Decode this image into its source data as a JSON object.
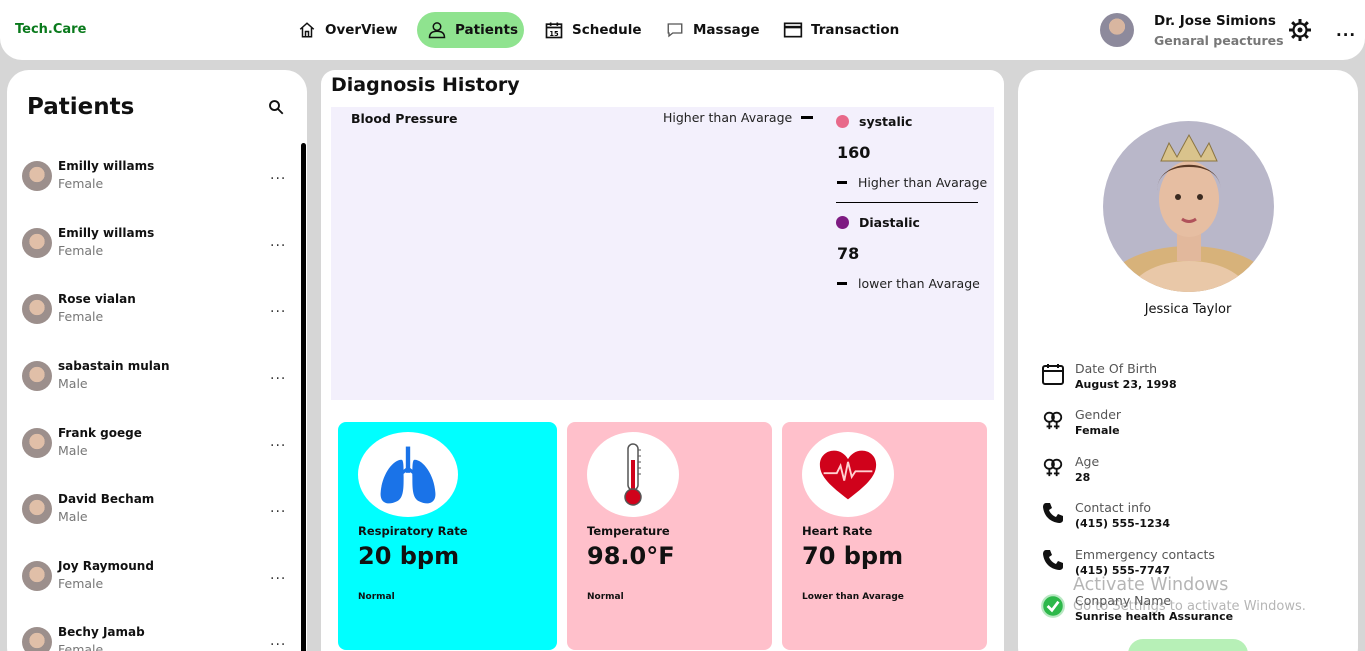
{
  "brand": "Tech.Care",
  "nav": {
    "overview": "OverView",
    "patients": "Patients",
    "schedule": "Schedule",
    "message": "Massage",
    "transaction": "Transaction"
  },
  "doctor": {
    "name": "Dr. Jose Simions",
    "role": "Genaral peactures"
  },
  "patients_panel": {
    "title": "Patients",
    "more_label": "...",
    "items": [
      {
        "name": "Emilly willams",
        "gender": "Female"
      },
      {
        "name": "Emilly willams",
        "gender": "Female"
      },
      {
        "name": "Rose vialan",
        "gender": "Female"
      },
      {
        "name": "sabastain mulan",
        "gender": "Male"
      },
      {
        "name": "Frank goege",
        "gender": "Male"
      },
      {
        "name": "David Becham",
        "gender": "Male"
      },
      {
        "name": "Joy Raymound",
        "gender": "Female"
      },
      {
        "name": "Bechy Jamab",
        "gender": "Female"
      }
    ]
  },
  "diagnosis": {
    "title": "Diagnosis History",
    "blood_pressure": {
      "title": "Blood Pressure",
      "note": "Higher than Avarage",
      "systolic": {
        "label": "systalic",
        "value": "160",
        "note": "Higher than Avarage",
        "color": "#e8698a"
      },
      "diastolic": {
        "label": "Diastalic",
        "value": "78",
        "note": "lower than Avarage",
        "color": "#7e1b82"
      }
    },
    "vitals": [
      {
        "label": "Respiratory Rate",
        "value": "20 bpm",
        "status": "Normal",
        "color": "#00ffff",
        "icon": "lungs-icon"
      },
      {
        "label": "Temperature",
        "value": "98.0°F",
        "status": "Normal",
        "color": "#ffc0cb",
        "icon": "thermometer-icon"
      },
      {
        "label": "Heart Rate",
        "value": "70 bpm",
        "status": "Lower than Avarage",
        "color": "#ffc0cb",
        "icon": "heart-icon"
      }
    ]
  },
  "profile": {
    "name": "Jessica Taylor",
    "dob_label": "Date Of Birth",
    "dob_value": "August 23, 1998",
    "gender_label": "Gender",
    "gender_value": "Female",
    "age_label": "Age",
    "age_value": "28",
    "contact_label": "Contact info",
    "contact_value": "(415) 555-1234",
    "emergency_label": "Emmergency contacts",
    "emergency_value": "(415) 555-7747",
    "company_label": "Conpany Name",
    "company_value": "Sunrise health Assurance"
  },
  "watermark": {
    "line1": "Activate Windows",
    "line2": "Go to Settings to activate Windows."
  },
  "colors": {
    "accent_green": "#8fe38f",
    "brand_green": "#0a7a1c"
  }
}
